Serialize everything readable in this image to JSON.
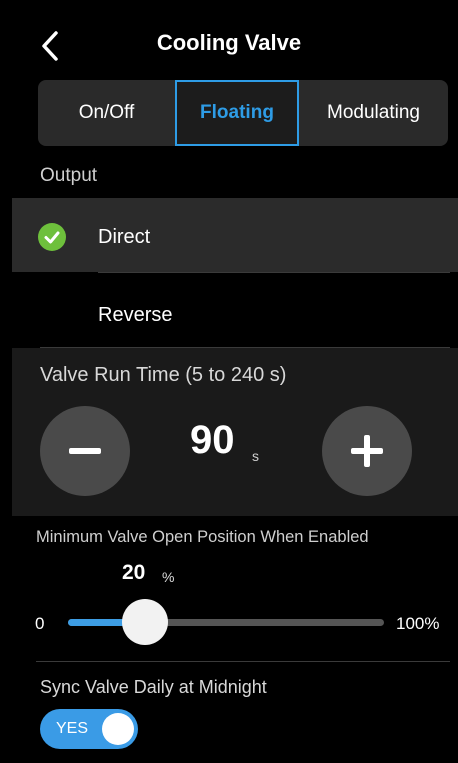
{
  "header": {
    "title": "Cooling Valve",
    "back_icon": "chevron-left-icon"
  },
  "mode_tabs": [
    {
      "label": "On/Off",
      "selected": false
    },
    {
      "label": "Floating",
      "selected": true
    },
    {
      "label": "Modulating",
      "selected": false
    }
  ],
  "output": {
    "label": "Output",
    "options": [
      {
        "label": "Direct",
        "selected": true
      },
      {
        "label": "Reverse",
        "selected": false
      }
    ]
  },
  "run_time": {
    "label": "Valve Run Time (5 to 240 s)",
    "value": "90",
    "unit": "s",
    "decrement_icon": "minus-icon",
    "increment_icon": "plus-icon"
  },
  "min_open": {
    "label": "Minimum Valve Open Position When Enabled",
    "value": "20",
    "unit": "%",
    "min_label": "0",
    "max_label": "100%",
    "level": 0.2
  },
  "sync": {
    "label": "Sync Valve Daily at Midnight",
    "toggle_label": "YES",
    "on": true
  },
  "colors": {
    "accent": "#3a9be6",
    "check": "#6ec03c",
    "button": "#4a4a4a"
  }
}
